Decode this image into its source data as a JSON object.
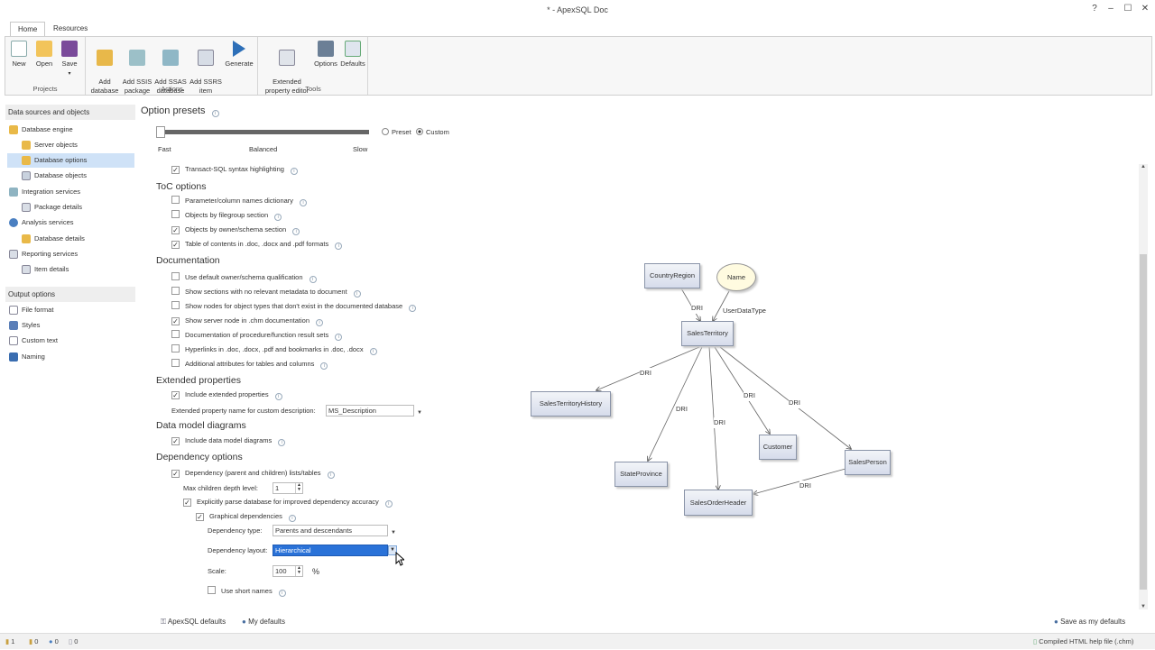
{
  "window": {
    "title": "* - ApexSQL Doc",
    "help": "?",
    "minimize": "–",
    "maximize": "☐",
    "close": "✕"
  },
  "tabs": [
    {
      "label": "Home"
    },
    {
      "label": "Resources"
    }
  ],
  "ribbon": {
    "projects": {
      "title": "Projects",
      "new": "New",
      "open": "Open",
      "save": "Save"
    },
    "actions": {
      "title": "Actions",
      "add_database": "Add\ndatabase",
      "add_ssis": "Add SSIS\npackage",
      "add_ssas": "Add SSAS\ndatabase",
      "add_ssrs": "Add SSRS\nitem",
      "generate": "Generate"
    },
    "tools": {
      "title": "Tools",
      "extended": "Extended\nproperty editor",
      "options": "Options",
      "defaults": "Defaults"
    }
  },
  "sidebar": {
    "section1": "Data sources and objects",
    "items1": [
      {
        "label": "Database engine"
      },
      {
        "label": "Server objects"
      },
      {
        "label": "Database options"
      },
      {
        "label": "Database objects"
      },
      {
        "label": "Integration services"
      },
      {
        "label": "Package details"
      },
      {
        "label": "Analysis services"
      },
      {
        "label": "Database details"
      },
      {
        "label": "Reporting services"
      },
      {
        "label": "Item details"
      }
    ],
    "section2": "Output options",
    "items2": [
      {
        "label": "File format"
      },
      {
        "label": "Styles"
      },
      {
        "label": "Custom text"
      },
      {
        "label": "Naming"
      }
    ]
  },
  "presets": {
    "title": "Option presets",
    "fast": "Fast",
    "balanced": "Balanced",
    "slow": "Slow",
    "preset": "Preset",
    "custom": "Custom",
    "slider_level": 0
  },
  "syntax": {
    "label": "Transact-SQL syntax highlighting",
    "checked": true
  },
  "toc": {
    "title": "ToC options",
    "items": [
      {
        "label": "Parameter/column names dictionary",
        "checked": false
      },
      {
        "label": "Objects by filegroup section",
        "checked": false
      },
      {
        "label": "Objects by owner/schema section",
        "checked": true
      },
      {
        "label": "Table of contents in .doc, .docx and .pdf formats",
        "checked": true
      }
    ]
  },
  "documentation": {
    "title": "Documentation",
    "items": [
      {
        "label": "Use default owner/schema qualification",
        "checked": false
      },
      {
        "label": "Show sections with no relevant metadata to document",
        "checked": false
      },
      {
        "label": "Show nodes for object types that don't exist in the documented database",
        "checked": false
      },
      {
        "label": "Show server node in .chm documentation",
        "checked": true
      },
      {
        "label": "Documentation of procedure/function result sets",
        "checked": false
      },
      {
        "label": "Hyperlinks in .doc, .docx, .pdf and bookmarks in .doc, .docx",
        "checked": false
      },
      {
        "label": "Additional attributes for tables and columns",
        "checked": false
      }
    ]
  },
  "extended": {
    "title": "Extended properties",
    "include": "Include extended properties",
    "include_checked": true,
    "name_label": "Extended property name for custom description:",
    "name_value": "MS_Description"
  },
  "datamodel": {
    "title": "Data model diagrams",
    "include": "Include data model diagrams",
    "include_checked": true
  },
  "dependency": {
    "title": "Dependency options",
    "lists": "Dependency (parent and children) lists/tables",
    "lists_checked": true,
    "max_depth_label": "Max children depth level:",
    "max_depth_value": "1",
    "parse": "Explicitly parse database for improved dependency accuracy",
    "parse_checked": true,
    "graphical": "Graphical dependencies",
    "graphical_checked": true,
    "type_label": "Dependency type:",
    "type_value": "Parents and descendants",
    "layout_label": "Dependency layout:",
    "layout_value": "Hierarchical",
    "scale_label": "Scale:",
    "scale_value": "100",
    "scale_unit": "%",
    "short": "Use short names",
    "short_checked": false
  },
  "diagram": {
    "nodes": {
      "countryregion": "CountryRegion",
      "name": "Name",
      "salesterritory": "SalesTerritory",
      "history": "SalesTerritoryHistory",
      "stateprovince": "StateProvince",
      "salesorderheader": "SalesOrderHeader",
      "customer": "Customer",
      "salesperson": "SalesPerson"
    },
    "edge_labels": {
      "dri": "DRI",
      "udt": "UserDataType"
    }
  },
  "bottom": {
    "apexsql_defaults": "ApexSQL defaults",
    "my_defaults": "My defaults",
    "save_defaults": "Save as my defaults"
  },
  "status": {
    "c1": "1",
    "c2": "0",
    "c3": "0",
    "c4": "0",
    "output": "Compiled HTML help file (.chm)"
  }
}
